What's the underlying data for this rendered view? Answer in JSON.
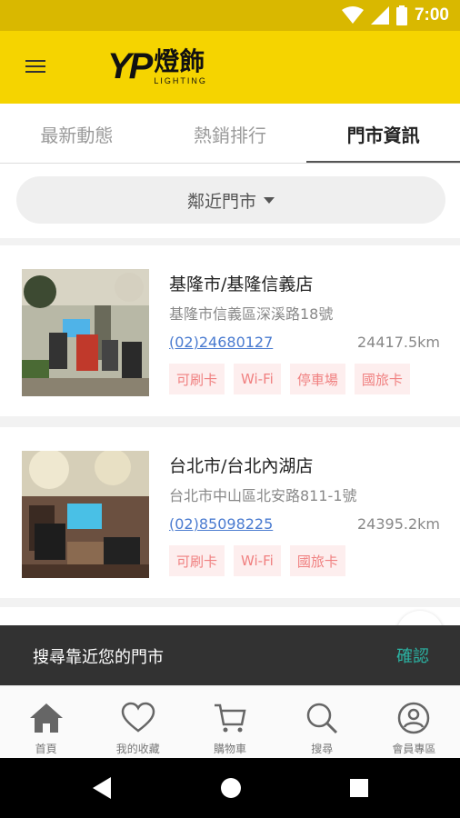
{
  "status_bar": {
    "time": "7:00"
  },
  "app_bar": {
    "logo_letters": "YP",
    "logo_chinese": "燈飾",
    "logo_sub": "LIGHTING"
  },
  "tabs": [
    {
      "label": "最新動態",
      "active": false
    },
    {
      "label": "熱銷排行",
      "active": false
    },
    {
      "label": "門市資訊",
      "active": true
    }
  ],
  "filter": {
    "label": "鄰近門市"
  },
  "stores": [
    {
      "name": "基隆市/基隆信義店",
      "address": "基隆市信義區深溪路18號",
      "phone": "(02)24680127",
      "distance": "24417.5km",
      "tags": [
        "可刷卡",
        "Wi-Fi",
        "停車場",
        "國旅卡"
      ]
    },
    {
      "name": "台北市/台北內湖店",
      "address": "台北市中山區北安路811-1號",
      "phone": "(02)85098225",
      "distance": "24395.2km",
      "tags": [
        "可刷卡",
        "Wi-Fi",
        "國旅卡"
      ]
    }
  ],
  "snackbar": {
    "text": "搜尋靠近您的門市",
    "action": "確認"
  },
  "bottom_nav": [
    {
      "label": "首頁",
      "icon": "home-icon"
    },
    {
      "label": "我的收藏",
      "icon": "heart-icon"
    },
    {
      "label": "購物車",
      "icon": "cart-icon"
    },
    {
      "label": "搜尋",
      "icon": "search-icon"
    },
    {
      "label": "會員專區",
      "icon": "user-icon"
    }
  ],
  "colors": {
    "brand_yellow": "#f5d400",
    "status_yellow": "#d9b800",
    "tag_text": "#f08080",
    "tag_bg": "#fdeeee",
    "phone_link": "#4a7bd0",
    "snack_action": "#2bb3a3"
  }
}
